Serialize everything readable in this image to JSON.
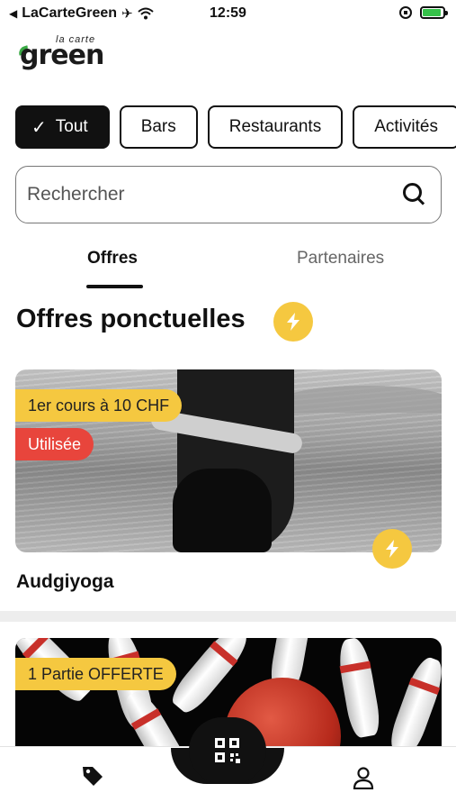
{
  "status_bar": {
    "back_app": "LaCarteGreen",
    "time": "12:59",
    "battery_level": 0.9
  },
  "logo": {
    "small_text": "la carte",
    "main_text": "green"
  },
  "filters": {
    "items": [
      {
        "label": "Tout",
        "active": true
      },
      {
        "label": "Bars",
        "active": false
      },
      {
        "label": "Restaurants",
        "active": false
      },
      {
        "label": "Activités",
        "active": false
      }
    ]
  },
  "search": {
    "placeholder": "Rechercher"
  },
  "tabs": {
    "offres": "Offres",
    "partenaires": "Partenaires"
  },
  "section": {
    "title": "Offres ponctuelles"
  },
  "offers": [
    {
      "title": "Audgiyoga",
      "tags": [
        "1er cours à 10 CHF",
        "Utilisée"
      ]
    },
    {
      "title": "",
      "tags": [
        "1 Partie OFFERTE"
      ]
    }
  ],
  "colors": {
    "accent_yellow": "#f5c840",
    "used_red": "#e8453c",
    "primary": "#111111"
  },
  "icons": {
    "search": "search-icon",
    "bolt": "lightning-bolt-icon",
    "qr": "qr-code-icon",
    "tag": "price-tag-icon",
    "user": "user-icon"
  }
}
